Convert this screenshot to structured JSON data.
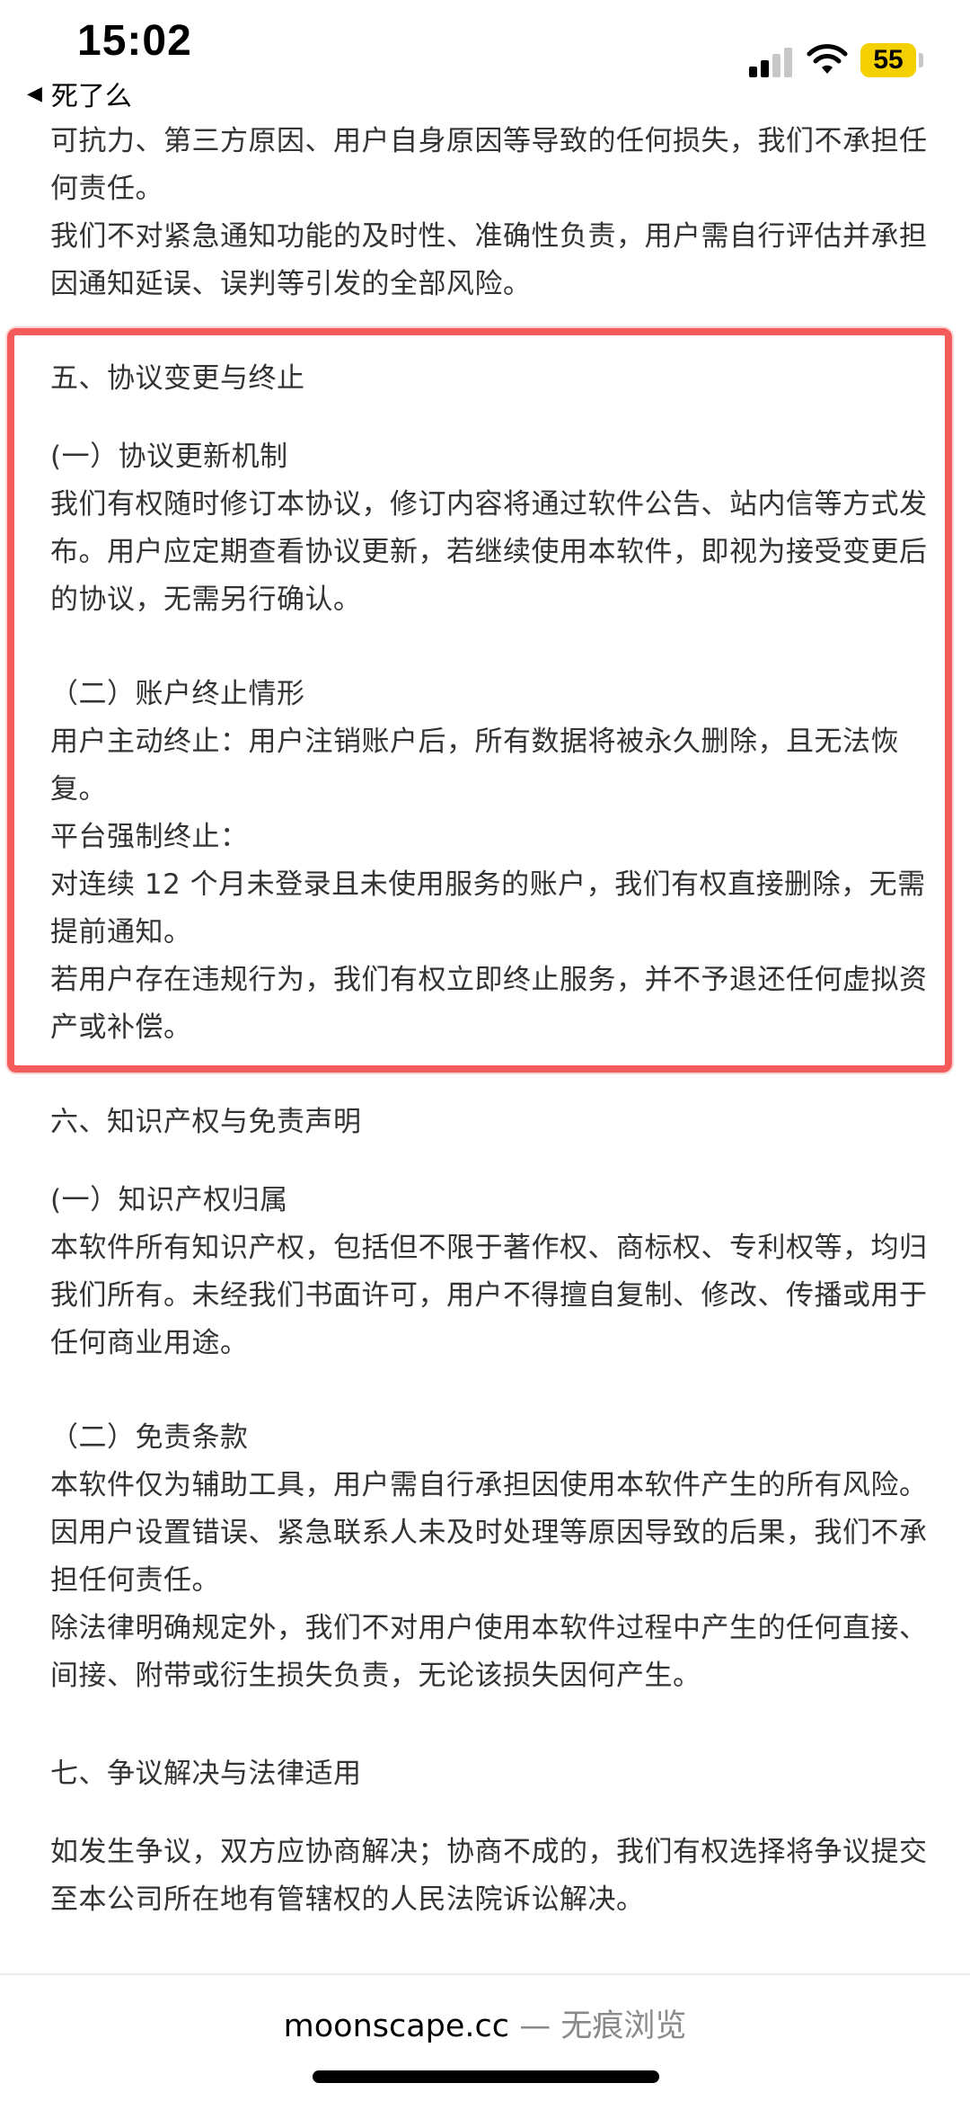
{
  "status_bar": {
    "time": "15:02",
    "back_label": "死了么",
    "battery": "55",
    "battery_color": "#f5d000"
  },
  "content": {
    "p1": "可抗力、第三方原因、用户自身原因等导致的任何损失，我们不承担任何责任。",
    "p2": "我们不对紧急通知功能的及时性、准确性负责，用户需自行评估并承担因通知延误、误判等引发的全部风险。",
    "section5_title": "五、协议变更与终止",
    "s5_1_title": "(一）协议更新机制",
    "s5_1_body": "我们有权随时修订本协议，修订内容将通过软件公告、站内信等方式发布。用户应定期查看协议更新，若继续使用本软件，即视为接受变更后的协议，无需另行确认。",
    "s5_2_title": "（二）账户终止情形",
    "s5_2_user": "用户主动终止：用户注销账户后，所有数据将被永久删除，且无法恢复。",
    "s5_2_platform_label": "平台强制终止：",
    "s5_2_platform_1": "对连续 12 个月未登录且未使用服务的账户，我们有权直接删除，无需提前通知。",
    "s5_2_platform_2": "若用户存在违规行为，我们有权立即终止服务，并不予退还任何虚拟资产或补偿。",
    "section6_title": "六、知识产权与免责声明",
    "s6_1_title": "(一）知识产权归属",
    "s6_1_body": "本软件所有知识产权，包括但不限于著作权、商标权、专利权等，均归我们所有。未经我们书面许可，用户不得擅自复制、修改、传播或用于任何商业用途。",
    "s6_2_title": "（二）免责条款",
    "s6_2_body1": "本软件仅为辅助工具，用户需自行承担因使用本软件产生的所有风险。因用户设置错误、紧急联系人未及时处理等原因导致的后果，我们不承担任何责任。",
    "s6_2_body2": "除法律明确规定外，我们不对用户使用本软件过程中产生的任何直接、间接、附带或衍生损失负责，无论该损失因何产生。",
    "section7_title": "七、争议解决与法律适用",
    "s7_body": "如发生争议，双方应协商解决；协商不成的，我们有权选择将争议提交至本公司所在地有管辖权的人民法院诉讼解决。"
  },
  "highlight_color": "#f45b5b",
  "footer": {
    "domain": "moonscape.cc",
    "suffix": " — 无痕浏览"
  }
}
